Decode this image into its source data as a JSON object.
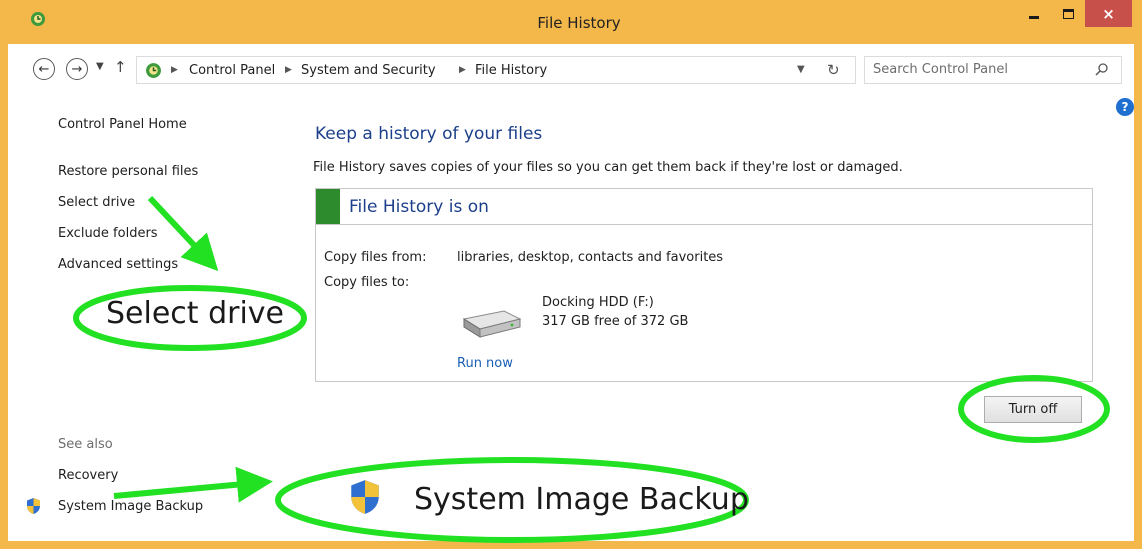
{
  "window": {
    "title": "File History",
    "close_glyph": "×"
  },
  "toolbar": {
    "back_icon": "back-arrow-icon",
    "forward_icon": "forward-arrow-icon",
    "up_icon": "up-arrow-icon",
    "refresh_icon": "refresh-icon"
  },
  "address_bar": {
    "crumbs": [
      "Control Panel",
      "System and Security",
      "File History"
    ]
  },
  "search": {
    "placeholder": "Search Control Panel"
  },
  "left_pane": {
    "home": "Control Panel Home",
    "links": [
      "Restore personal files",
      "Select drive",
      "Exclude folders",
      "Advanced settings"
    ],
    "see_also_label": "See also",
    "see_also": [
      "Recovery",
      "System Image Backup"
    ]
  },
  "main": {
    "heading": "Keep a history of your files",
    "description": "File History saves copies of your files so you can get them back if they're lost or damaged.",
    "status_title": "File History is on",
    "copy_from_label": "Copy files from:",
    "copy_from_value": "libraries, desktop, contacts and favorites",
    "copy_to_label": "Copy files to:",
    "drive_name": "Docking HDD (F:)",
    "drive_free": "317 GB free of 372 GB",
    "run_now": "Run now",
    "turn_off": "Turn off"
  },
  "callouts": {
    "select_drive": "Select drive",
    "system_image_backup": "System Image Backup",
    "highlight_color": "#22e022"
  },
  "colors": {
    "titlebar": "#f3b74a",
    "close_button": "#c7504a",
    "status_on": "#2d8a2d",
    "heading_blue": "#1c3f8a",
    "link_blue": "#1a5fb4"
  }
}
